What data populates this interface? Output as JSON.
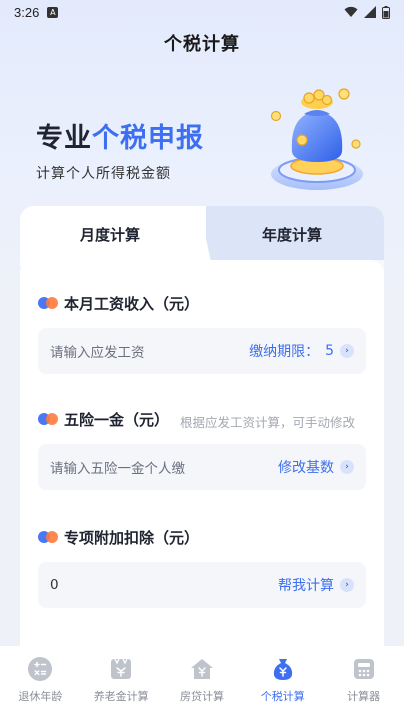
{
  "status_bar": {
    "time": "3:26",
    "notification_letter": "A"
  },
  "header": {
    "title": "个税计算"
  },
  "banner": {
    "title_part1": "专业",
    "title_part2": "个税申报",
    "subtitle": "计算个人所得税金额"
  },
  "tabs": [
    {
      "label": "月度计算",
      "active": true
    },
    {
      "label": "年度计算",
      "active": false
    }
  ],
  "sections": {
    "salary": {
      "title": "本月工资收入（元）",
      "placeholder": "请输入应发工资",
      "action_label": "缴纳期限：",
      "action_value": "5"
    },
    "insurance": {
      "title": "五险一金（元）",
      "hint": "根据应发工资计算，可手动修改",
      "placeholder": "请输入五险一金个人缴",
      "action_label": "修改基数"
    },
    "deduction": {
      "title": "专项附加扣除（元）",
      "value": "0",
      "action_label": "帮我计算"
    }
  },
  "nav": [
    {
      "label": "退休年龄",
      "icon": "calculator-ops-icon",
      "active": false
    },
    {
      "label": "养老金计算",
      "icon": "pension-icon",
      "active": false
    },
    {
      "label": "房贷计算",
      "icon": "house-yen-icon",
      "active": false
    },
    {
      "label": "个税计算",
      "icon": "money-bag-icon",
      "active": true
    },
    {
      "label": "计算器",
      "icon": "calculator-icon",
      "active": false
    }
  ],
  "colors": {
    "accent": "#3d6ff0",
    "orange": "#ff7a3d",
    "background": "#eef1f8"
  }
}
